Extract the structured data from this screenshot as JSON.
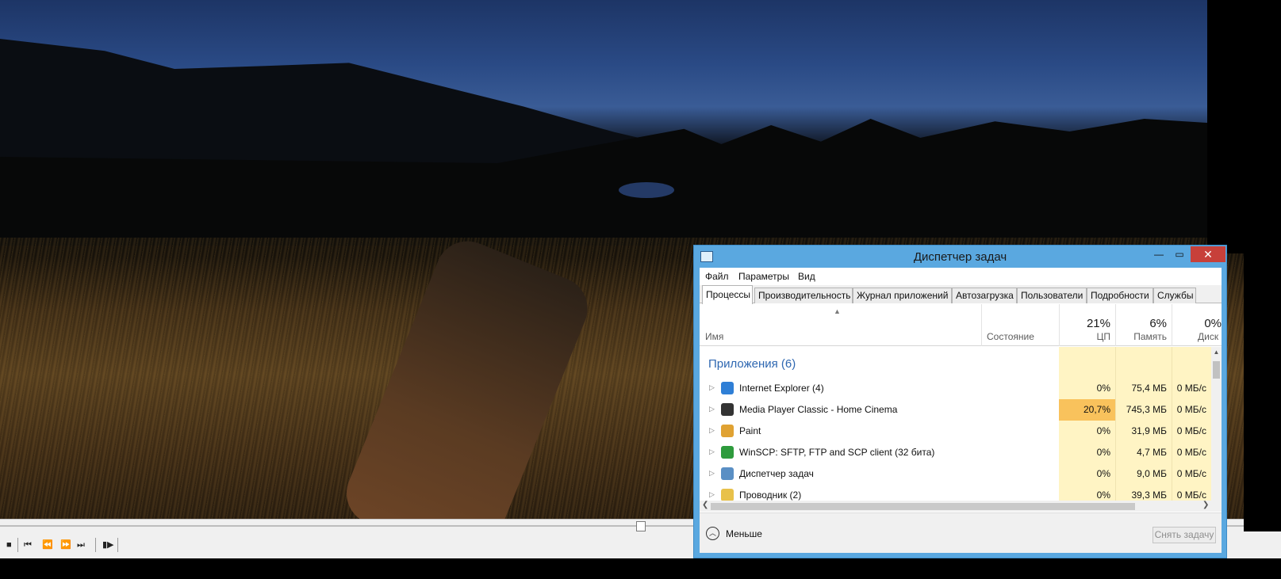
{
  "player": {
    "controls": [
      {
        "name": "stop-button",
        "glyph": "■"
      },
      {
        "name": "prev-button",
        "glyph": "⏮"
      },
      {
        "name": "rewind-button",
        "glyph": "⏪"
      },
      {
        "name": "forward-button",
        "glyph": "⏩"
      },
      {
        "name": "next-button",
        "glyph": "⏭"
      },
      {
        "name": "frame-step-button",
        "glyph": "▮▶"
      }
    ]
  },
  "taskmgr": {
    "title": "Диспетчер задач",
    "window_buttons": {
      "minimize": "—",
      "maximize": "▭",
      "close": "✕"
    },
    "menu": [
      "Файл",
      "Параметры",
      "Вид"
    ],
    "tabs": [
      "Процессы",
      "Производительность",
      "Журнал приложений",
      "Автозагрузка",
      "Пользователи",
      "Подробности",
      "Службы"
    ],
    "active_tab": "Процессы",
    "columns": {
      "name": "Имя",
      "status": "Состояние",
      "cpu_label": "ЦП",
      "cpu_pct": "21%",
      "mem_label": "Память",
      "mem_pct": "6%",
      "disk_label": "Диск",
      "disk_pct": "0%"
    },
    "group_title": "Приложения (6)",
    "rows": [
      {
        "name": "Internet Explorer (4)",
        "cpu": "0%",
        "mem": "75,4 МБ",
        "disk": "0 МБ/с",
        "icon": "ie-icon",
        "color": "#2f7fd6"
      },
      {
        "name": "Media Player Classic - Home Cinema",
        "cpu": "20,7%",
        "mem": "745,3 МБ",
        "disk": "0 МБ/с",
        "icon": "mpc-icon",
        "color": "#333333",
        "hot": true
      },
      {
        "name": "Paint",
        "cpu": "0%",
        "mem": "31,9 МБ",
        "disk": "0 МБ/с",
        "icon": "paint-icon",
        "color": "#e0a232"
      },
      {
        "name": "WinSCP: SFTP, FTP and SCP client (32 бита)",
        "cpu": "0%",
        "mem": "4,7 МБ",
        "disk": "0 МБ/с",
        "icon": "winscp-icon",
        "color": "#2e9b3d"
      },
      {
        "name": "Диспетчер задач",
        "cpu": "0%",
        "mem": "9,0 МБ",
        "disk": "0 МБ/с",
        "icon": "taskmgr-icon",
        "color": "#5a8fc4"
      },
      {
        "name": "Проводник (2)",
        "cpu": "0%",
        "mem": "39,3 МБ",
        "disk": "0 МБ/с",
        "icon": "explorer-icon",
        "color": "#e8c14a"
      }
    ],
    "footer": {
      "less": "Меньше",
      "end_task": "Снять задачу"
    },
    "colors": {
      "accent": "#5aa8e0",
      "group": "#2e67b1",
      "cell_light": "#fff4c4",
      "cell_hot": "#f9c25c",
      "close": "#c7403a"
    }
  }
}
